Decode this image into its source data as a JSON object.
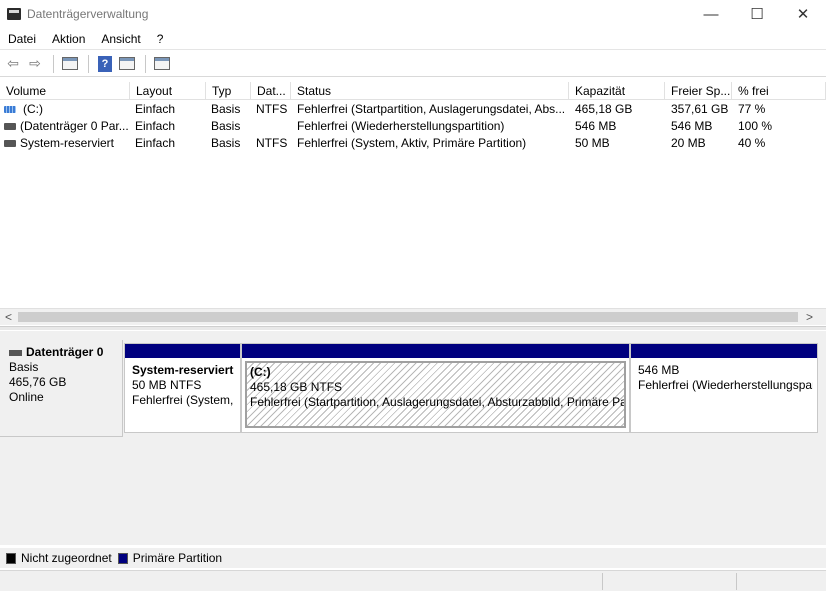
{
  "window": {
    "title": "Datenträgerverwaltung",
    "controls": {
      "minimize": "—",
      "maximize": "☐",
      "close": "✕"
    }
  },
  "menubar": {
    "items": [
      "Datei",
      "Aktion",
      "Ansicht",
      "?"
    ]
  },
  "toolbar": {
    "back": "⇦",
    "forward": "⇨",
    "help": "?"
  },
  "volume_list": {
    "columns": [
      "Volume",
      "Layout",
      "Typ",
      "Dat...",
      "Status",
      "Kapazität",
      "Freier Sp...",
      "% frei"
    ],
    "rows": [
      {
        "volume": "(C:)",
        "layout": "Einfach",
        "typ": "Basis",
        "dat": "NTFS",
        "status": "Fehlerfrei (Startpartition, Auslagerungsdatei, Abs...",
        "kapazitaet": "465,18 GB",
        "frei": "357,61 GB",
        "prozent": "77 %",
        "icon": "volume-c-icon"
      },
      {
        "volume": "(Datenträger 0 Par...",
        "layout": "Einfach",
        "typ": "Basis",
        "dat": "",
        "status": "Fehlerfrei (Wiederherstellungspartition)",
        "kapazitaet": "546 MB",
        "frei": "546 MB",
        "prozent": "100 %",
        "icon": "volume-icon"
      },
      {
        "volume": "System-reserviert",
        "layout": "Einfach",
        "typ": "Basis",
        "dat": "NTFS",
        "status": "Fehlerfrei (System, Aktiv, Primäre Partition)",
        "kapazitaet": "50 MB",
        "frei": "20 MB",
        "prozent": "40 %",
        "icon": "volume-icon"
      }
    ],
    "scroll_left": "<",
    "scroll_right": ">"
  },
  "disk": {
    "name": "Datenträger 0",
    "type": "Basis",
    "size": "465,76 GB",
    "state": "Online",
    "partitions": [
      {
        "name": "System-reserviert",
        "size": "50 MB NTFS",
        "status": "Fehlerfrei (System, Aktiv, Primäre Partition)"
      },
      {
        "name": "(C:)",
        "size": "465,18 GB NTFS",
        "status": "Fehlerfrei (Startpartition, Auslagerungsdatei, Absturzabbild, Primäre Partition)"
      },
      {
        "name": "",
        "size": "546 MB",
        "status": "Fehlerfrei (Wiederherstellungspartition)"
      }
    ]
  },
  "legend": {
    "items": [
      {
        "label": "Nicht zugeordnet",
        "color": "#000000"
      },
      {
        "label": "Primäre Partition",
        "color": "#00007f"
      }
    ]
  }
}
